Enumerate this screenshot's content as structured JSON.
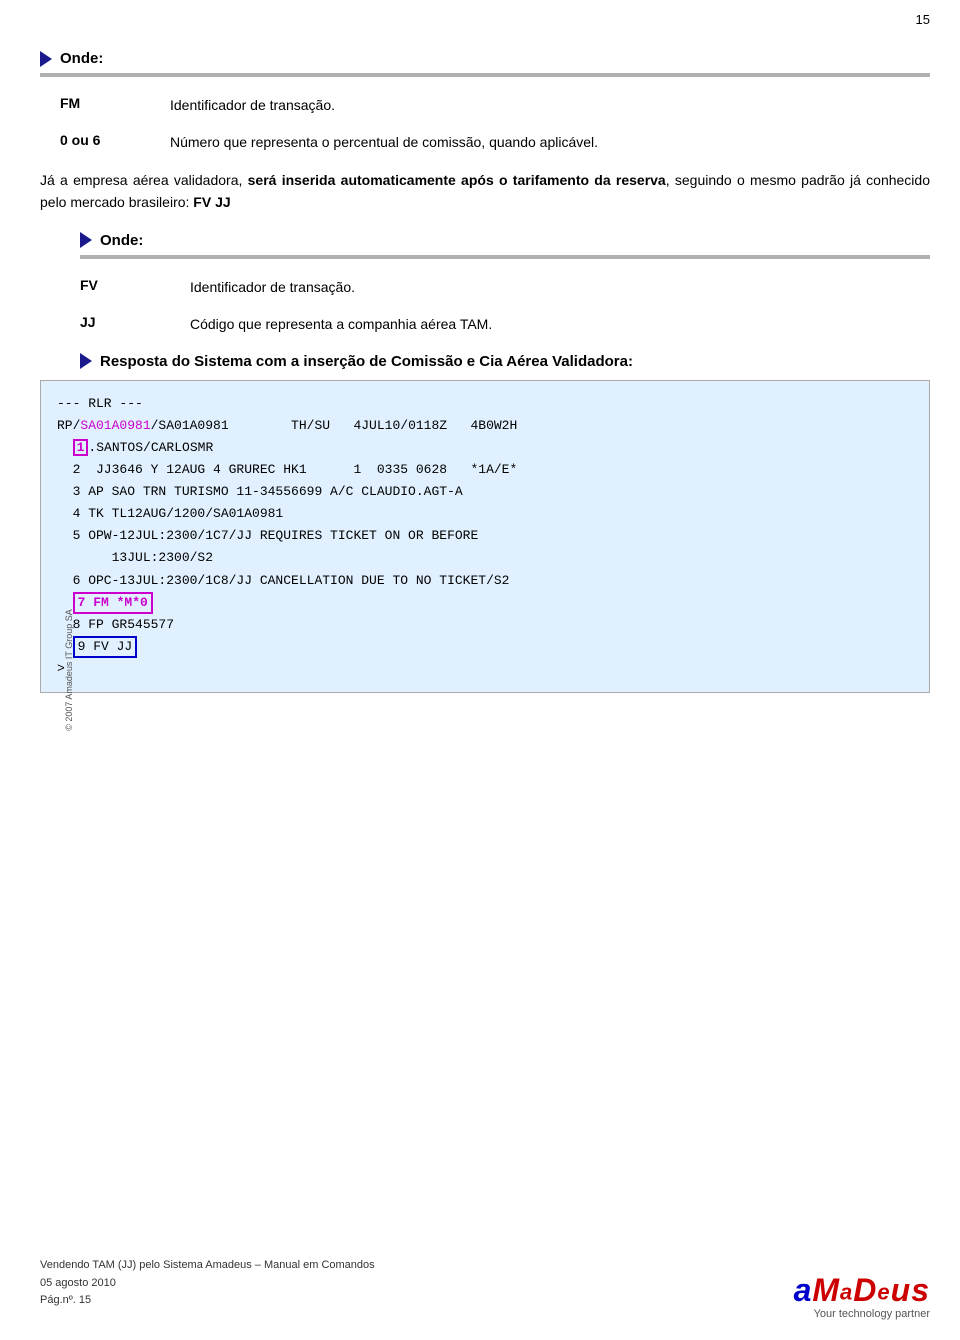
{
  "page": {
    "number": "15",
    "side_label": "© 2007 Amadeus IT Group SA"
  },
  "section1": {
    "title": "Onde:",
    "definitions": [
      {
        "term": "FM",
        "desc": "Identificador de transação."
      },
      {
        "term": "0 ou 6",
        "desc": "Número  que  representa  o  percentual  de comissão, quando aplicável."
      }
    ]
  },
  "paragraph1": {
    "text_before": "Já a empresa aérea validadora, ",
    "bold1": "será inserida automaticamente após o tarifamento da reserva",
    "text_after": ", seguindo o mesmo padrão já conhecido pelo mercado brasileiro: ",
    "bold2": "FV JJ"
  },
  "section2": {
    "title": "Onde:",
    "definitions": [
      {
        "term": "FV",
        "desc": "Identificador de transação."
      },
      {
        "term": "JJ",
        "desc": "Código  que  representa  a  companhia  aérea TAM."
      }
    ]
  },
  "section3": {
    "title": "Resposta do Sistema com a inserção de Comissão e Cia Aérea Validadora:"
  },
  "terminal": {
    "lines": [
      {
        "type": "normal",
        "content": "--- RLR ---"
      },
      {
        "type": "mixed",
        "parts": [
          {
            "style": "normal",
            "text": "RP/"
          },
          {
            "style": "magenta",
            "text": "SA01A0981"
          },
          {
            "style": "normal",
            "text": "/SA01A0981        TH/SU   4JUL10/0118Z   4B0W2H"
          }
        ]
      },
      {
        "type": "mixed",
        "parts": [
          {
            "style": "normal",
            "text": "  "
          },
          {
            "style": "box-magenta",
            "text": "1"
          },
          {
            "style": "normal",
            "text": ".SANTOS/CARLOSMR"
          }
        ]
      },
      {
        "type": "normal",
        "content": "  2  JJ3646 Y 12AUG 4 GRUREC HK1      1  0335 0628   *1A/E*"
      },
      {
        "type": "normal",
        "content": "  3 AP SAO TRN TURISMO 11-34556699 A/C CLAUDIO.AGT-A"
      },
      {
        "type": "normal",
        "content": "  4 TK TL12AUG/1200/SA01A0981"
      },
      {
        "type": "normal",
        "content": "  5 OPW-12JUL:2300/1C7/JJ REQUIRES TICKET ON OR BEFORE"
      },
      {
        "type": "normal",
        "content": "       13JUL:2300/S2"
      },
      {
        "type": "normal",
        "content": "  6 OPC-13JUL:2300/1C8/JJ CANCELLATION DUE TO NO TICKET/S2"
      },
      {
        "type": "mixed",
        "parts": [
          {
            "style": "normal",
            "text": "  "
          },
          {
            "style": "box-magenta-text",
            "text": "7 FM *M*0"
          }
        ]
      },
      {
        "type": "normal",
        "content": "  8 FP GR545577"
      },
      {
        "type": "mixed",
        "parts": [
          {
            "style": "normal",
            "text": "  "
          },
          {
            "style": "box-blue",
            "text": "9 FV JJ"
          }
        ]
      }
    ],
    "prompt": ">"
  },
  "footer": {
    "line1": "Vendendo TAM (JJ) pelo Sistema Amadeus – Manual em Comandos",
    "line2": "05 agosto 2010",
    "line3": "Pág.nº. 15"
  },
  "logo": {
    "name": "aMaDeus",
    "tagline": "Your technology partner"
  }
}
